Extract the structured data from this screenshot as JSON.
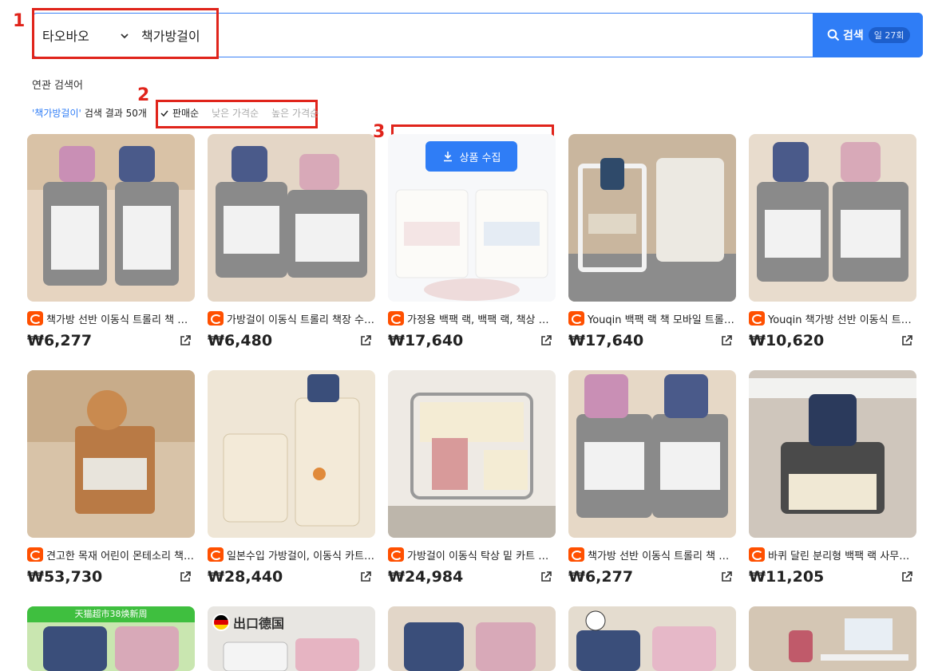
{
  "search": {
    "platform": "타오바오",
    "query": "책가방걸이",
    "button_label": "검색",
    "quota": "일 27회"
  },
  "annotations": [
    "1",
    "2",
    "3"
  ],
  "related_label": "연관 검색어",
  "results": {
    "keyword": "'책가방걸이'",
    "summary": "검색 결과 50개"
  },
  "sorts": [
    {
      "label": "판매순",
      "active": true
    },
    {
      "label": "낮은 가격순",
      "active": false
    },
    {
      "label": "높은 가격순",
      "active": false
    }
  ],
  "collect_button": "상품 수집",
  "products": [
    {
      "title": "책가방 선반 이동식 트롤리 책 보관함 수납 선반",
      "price": "₩6,277"
    },
    {
      "title": "가방걸이 이동식 트롤리 책장 수납 선반",
      "price": "₩6,480"
    },
    {
      "title": "가정용 백팩 랙, 백팩 랙, 책상 아래 수납",
      "price": "₩17,640"
    },
    {
      "title": "Youqin 백팩 랙 책 모바일 트롤리 수납",
      "price": "₩17,640"
    },
    {
      "title": "Youqin 책가방 선반 이동식 트롤리",
      "price": "₩10,620"
    },
    {
      "title": "견고한 목재 어린이 몬테소리 책장 수납",
      "price": "₩53,730"
    },
    {
      "title": "일본수입 가방걸이, 이동식 카트, 수납",
      "price": "₩28,440"
    },
    {
      "title": "가방걸이 이동식 탁상 밑 카트 가방 수납",
      "price": "₩24,984"
    },
    {
      "title": "책가방 선반 이동식 트롤리 책 보관함",
      "price": "₩6,277"
    },
    {
      "title": "바퀴 달린 분리형 백팩 랙 사무실 수납",
      "price": "₩11,205"
    }
  ],
  "bottom_promos": {
    "tmall": "天猫超市38焕新周",
    "export": "出口德国"
  }
}
